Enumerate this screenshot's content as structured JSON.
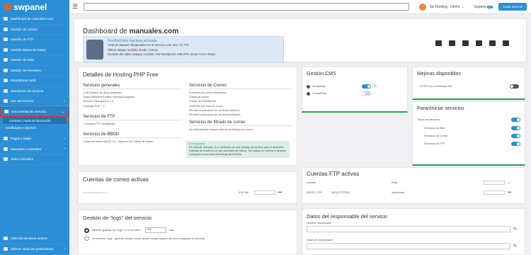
{
  "app": {
    "logo": "swpanel"
  },
  "sidebar": {
    "items": [
      {
        "label": "Dashboard de manuales.com",
        "chev": ""
      },
      {
        "label": "Gestión de Correo",
        "chev": ""
      },
      {
        "label": "Gestión de FTP",
        "chev": ""
      },
      {
        "label": "Gestión Bases de Datos",
        "chev": ""
      },
      {
        "label": "Gestión de DNS",
        "chev": ""
      },
      {
        "label": "Gestión de Permisos",
        "chev": ""
      },
      {
        "label": "Estadísticas Web",
        "chev": ""
      },
      {
        "label": "Servidores del servicio",
        "chev": ""
      },
      {
        "label": "Uso del servicio",
        "chev": "›"
      },
      {
        "label": "Documentación Servicio",
        "chev": "⌄"
      }
    ],
    "sub_active": "Contrato y modo de facturación",
    "sub_item": "Certificados e informes",
    "items2": [
      {
        "label": "Pagos y Bajas",
        "chev": "›"
      },
      {
        "label": "Manuales y tutoriales",
        "chev": "›"
      },
      {
        "label": "Vídeo tutoriales",
        "chev": ""
      }
    ],
    "bottom": [
      {
        "label": "Árbol de servicios activos",
        "chev": ""
      },
      {
        "label": "Últimos servicios gestionados",
        "chev": "›"
      }
    ]
  },
  "topbar": {
    "account": "Sw Hosting - Demo",
    "support": "Soporte",
    "support_badge": "9+",
    "create_button": "Crear servicio"
  },
  "dashboard": {
    "title_prefix": "Dashboard de",
    "title_domain": "manuales.com",
    "firewall": {
      "title": "FireWall Anti Hacking activado",
      "line1": "Total de ataques bloqueados en el servicio este año: 71.772",
      "line2": "Último ataque recibido desde: France",
      "line3": "Nombre del último ataque recibido: SW Wordpress XMLRPC Brute Force Attack"
    }
  },
  "hosting": {
    "title": "Detalles de Hosting PHP Free",
    "general_title": "Servicios generales",
    "general": [
      "1 GB espacio de disco asignado.",
      "Tráfico ilimitado[*] tráfico mensual asignado.",
      "Servidor Web Apache 2.4",
      "Lenguaje PHP 7.2"
    ],
    "ftp_title": "Servicios de FTP",
    "ftp": [
      "7 cuentas FTP contratadas"
    ],
    "db_title": "Servicios de BBDD",
    "db": [
      "1 base de Datos MySQL 5.7, disponer de 1 Base de Datos"
    ],
    "mail_title": "Servicios de Correo",
    "mail": [
      "5 cuentas de correo electrónico",
      "3 alias de correo",
      "3 listas de Distribución",
      "1,000/Sin por hora de correo",
      "Permite la activación de servicios antivirus",
      "Permite la activación de servicios antispam"
    ],
    "filter_title": "Servicios de filtrado de correo",
    "filter": [
      "No está activado ningún sistema de filtrado de correo."
    ],
    "note_title": "(*) Importante",
    "note": "Se entiende 'ilimitado' la no limitación de esta variable del servicio para el desarrollo estándar de la web en un uso razonable del mismo. Sin hosting se reserva el derecho a bloquear el uso para sobrecarga del servidor."
  },
  "cms": {
    "title": "Gestión CMS",
    "items": [
      {
        "label": "Wordpress",
        "on": true
      },
      {
        "label": "PrestaShop",
        "on": false
      }
    ]
  },
  "improve": {
    "title": "Mejoras disponibles",
    "items": [
      {
        "label": "HTTPS con certificado SSL"
      }
    ]
  },
  "services": {
    "title": "Parar/iniciar servicios",
    "all_label": "Todos los servicios",
    "items": [
      {
        "label": "Servicios de Web"
      },
      {
        "label": "Servicios de Correo"
      },
      {
        "label": "Servicios de FTP"
      }
    ]
  },
  "email_accounts": {
    "title": "Cuentas de correo activas",
    "row": {
      "account": "info@manuales.com",
      "size": "0.00 Mb"
    }
  },
  "ftp_accounts": {
    "title": "Cuentas FTP activas",
    "col_user": "Usuario",
    "col_path": "Ruta",
    "row": {
      "user": "SW127_FTP",
      "pass": "SW127FTP332",
      "path": "/datos/web"
    }
  },
  "logs": {
    "title": "Gestión de \"logs\" del servicio",
    "opt1_a": "Retener/guardar los \"logs\" en el servicio:",
    "opt1_days": "365",
    "opt1_b": "días",
    "opt2": "No eliminar \"logs\", guardar siempre (esta opción ocupa espacio del disco asignado al dominio)"
  },
  "owner": {
    "title": "Datos del responsable del servicio",
    "name_label": "Nombre responsable",
    "email_label": "email del responsable"
  }
}
